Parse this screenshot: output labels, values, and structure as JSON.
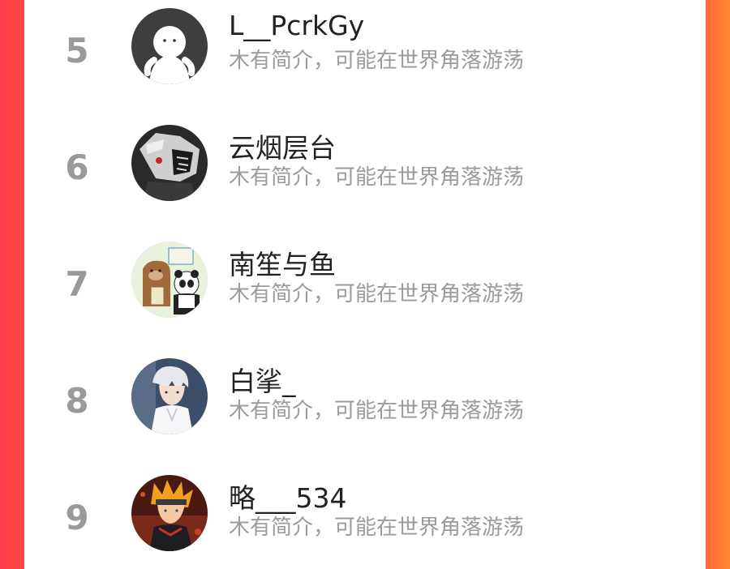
{
  "users": [
    {
      "rank": "5",
      "name": "L__PcrkGy",
      "bio": "木有简介，可能在世界角落游荡",
      "avatar": "white-figure-avatar-icon"
    },
    {
      "rank": "6",
      "name": "云烟层台",
      "bio": "木有简介，可能在世界角落游荡",
      "avatar": "anime-mask-avatar"
    },
    {
      "rank": "7",
      "name": "南笙与鱼",
      "bio": "木有简介，可能在世界角落游荡",
      "avatar": "bears-cartoon-avatar"
    },
    {
      "rank": "8",
      "name": "白挲_",
      "bio": "木有简介，可能在世界角落游荡",
      "avatar": "anime-white-hair-avatar"
    },
    {
      "rank": "9",
      "name": "略___534",
      "bio": "木有简介，可能在世界角落游荡",
      "avatar": "anime-orange-hair-avatar"
    }
  ],
  "colors": {
    "left_border": "#ff3b4e",
    "right_border": "#ff8a30",
    "rank_text": "#9a9a9a",
    "name_text": "#222222",
    "bio_text": "#9b9b9b"
  }
}
